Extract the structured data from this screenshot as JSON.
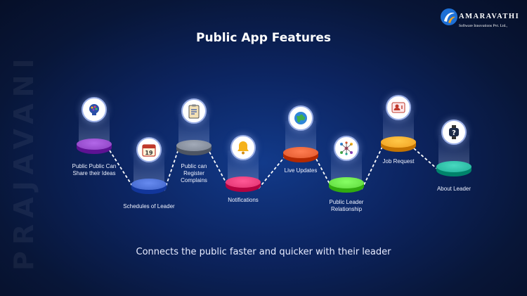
{
  "brand": {
    "name": "AMARAVATHI",
    "subtitle": "Software Innovations Pvt. Ltd.,",
    "side_text": "PRAJAVANI"
  },
  "page": {
    "title": "Public App Features",
    "tagline": "Connects the public faster and quicker with their leader"
  },
  "features": [
    {
      "label_lines": [
        "Public Public Can",
        "Share their Ideas"
      ],
      "icon": "ideas-head-icon",
      "color": "#8a3fc0"
    },
    {
      "label_lines": [
        "Schedules of Leader"
      ],
      "icon": "calendar-icon",
      "color": "#3f63c8"
    },
    {
      "label_lines": [
        "Public can",
        "Register",
        "Complains"
      ],
      "icon": "clipboard-icon",
      "color": "#7a8290"
    },
    {
      "label_lines": [
        "Notifications"
      ],
      "icon": "bell-icon",
      "color": "#e0306e"
    },
    {
      "label_lines": [
        "Live Updates"
      ],
      "icon": "globe-icon",
      "color": "#e0562a"
    },
    {
      "label_lines": [
        "Public Leader",
        "Relationship"
      ],
      "icon": "network-icon",
      "color": "#5ed83c"
    },
    {
      "label_lines": [
        "Job Request"
      ],
      "icon": "user-badge-icon",
      "color": "#f0a020"
    },
    {
      "label_lines": [
        "About Leader"
      ],
      "icon": "watch-question-icon",
      "color": "#20b098"
    }
  ]
}
